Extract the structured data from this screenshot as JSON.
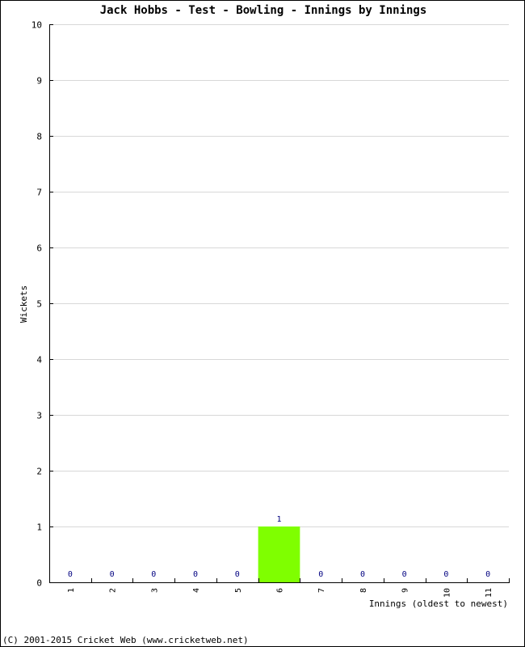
{
  "chart_data": {
    "type": "bar",
    "title": "Jack Hobbs - Test - Bowling - Innings by Innings",
    "xlabel": "Innings (oldest to newest)",
    "ylabel": "Wickets",
    "categories": [
      "1",
      "2",
      "3",
      "4",
      "5",
      "6",
      "7",
      "8",
      "9",
      "10",
      "11"
    ],
    "values": [
      0,
      0,
      0,
      0,
      0,
      1,
      0,
      0,
      0,
      0,
      0
    ],
    "ylim": [
      0,
      10
    ],
    "yticks": [
      0,
      1,
      2,
      3,
      4,
      5,
      6,
      7,
      8,
      9,
      10
    ],
    "grid": true,
    "bar_color": "#7fff00",
    "value_label_color": "#000080",
    "gridline_color": "#d8d8d8"
  },
  "footer": "(C) 2001-2015 Cricket Web (www.cricketweb.net)"
}
